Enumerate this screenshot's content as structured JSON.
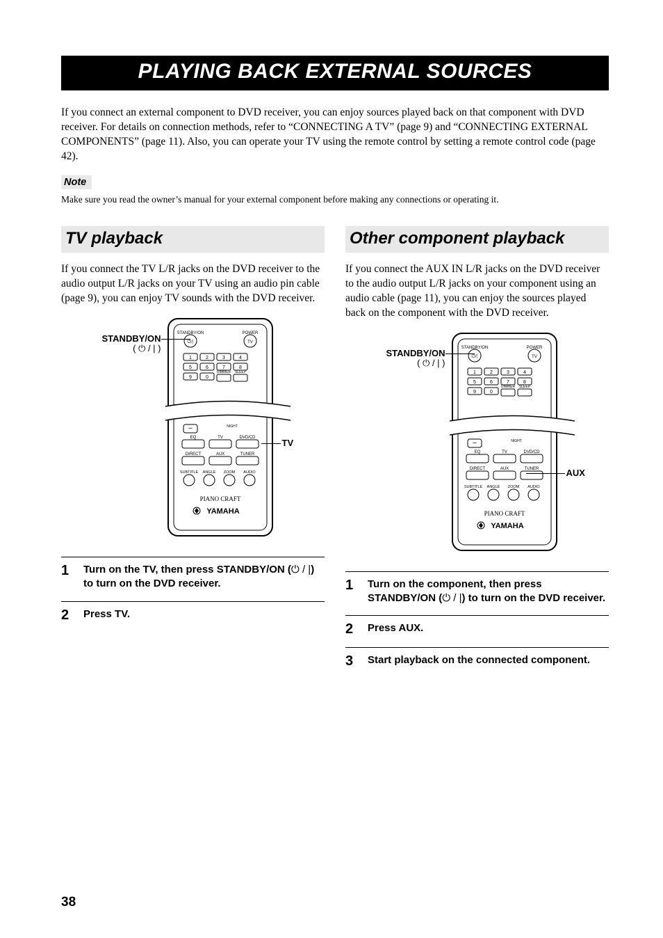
{
  "page_title": "PLAYING BACK EXTERNAL SOURCES",
  "intro": "If you connect an external component to DVD receiver, you can enjoy sources played back on that component with DVD receiver. For details on connection methods, refer to “CONNECTING A TV” (page 9) and “CONNECTING EXTERNAL COMPONENTS” (page 11). Also, you can operate your TV using the remote control by setting a remote control code (page 42).",
  "note_label": "Note",
  "note_text": "Make sure you read the owner’s manual for your external component before making any connections or operating it.",
  "left": {
    "heading": "TV playback",
    "intro": "If you connect the TV L/R jacks on the DVD receiver to the audio output L/R jacks on your TV using an audio pin cable (page 9), you can enjoy TV sounds with the DVD receiver.",
    "callout_standby": "STANDBY/ON",
    "callout_power_glyph": "( ⏻ / | )",
    "callout_side": "TV",
    "steps": [
      {
        "num": "1",
        "text_a": "Turn on the TV, then press STANDBY/ON (",
        "glyph": "⏻ / |",
        "text_b": ") to turn on the DVD receiver."
      },
      {
        "num": "2",
        "text_a": "Press TV.",
        "glyph": "",
        "text_b": ""
      }
    ]
  },
  "right": {
    "heading": "Other component playback",
    "intro": "If you connect the AUX IN L/R jacks on the DVD receiver to the audio output L/R jacks on your component using an audio cable (page 11), you can enjoy the sources played back on the component with the DVD receiver.",
    "callout_standby": "STANDBY/ON",
    "callout_power_glyph": "( ⏻ / | )",
    "callout_side": "AUX",
    "steps": [
      {
        "num": "1",
        "text_a": "Turn on the component, then press STANDBY/ON (",
        "glyph": "⏻ / |",
        "text_b": ") to turn on the DVD receiver."
      },
      {
        "num": "2",
        "text_a": "Press AUX.",
        "glyph": "",
        "text_b": ""
      },
      {
        "num": "3",
        "text_a": "Start playback on the connected component.",
        "glyph": "",
        "text_b": ""
      }
    ]
  },
  "remote": {
    "top_labels": {
      "standby": "STANDBY/ON",
      "power": "POWER",
      "tv": "TV"
    },
    "num_keys": [
      "1",
      "2",
      "3",
      "4",
      "5",
      "6",
      "7",
      "8",
      "9",
      "0"
    ],
    "dimmer": "DIMMER",
    "sleep": "SLEEP",
    "minus": "–",
    "night": "NIGHT",
    "row1": [
      "EQ",
      "TV",
      "DVD/CD"
    ],
    "row2": [
      "DIRECT",
      "AUX",
      "TUNER"
    ],
    "row3": [
      "SUBTITLE",
      "ANGLE",
      "ZOOM",
      "AUDIO"
    ],
    "brand_script": "PIANO CRAFT",
    "brand": "YAMAHA"
  },
  "page_number": "38"
}
